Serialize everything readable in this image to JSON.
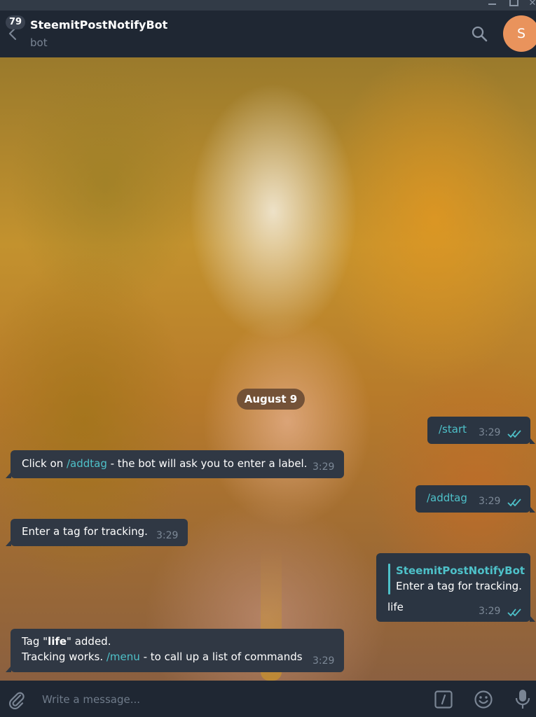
{
  "colors": {
    "accent": "#4ec1c9",
    "header_bg": "#1f2733",
    "avatar_bg": "#e9935c",
    "date_pill_bg": "#6b4c34"
  },
  "header": {
    "unread_count": "79",
    "title": "SteemitPostNotifyBot",
    "status": "bot",
    "avatar_letter": "S",
    "icons": [
      "back-arrow-icon",
      "search-icon"
    ]
  },
  "chat": {
    "date_separator": "August 9",
    "messages": [
      {
        "direction": "outgoing",
        "text": "/start",
        "time": "3:29",
        "read": true
      },
      {
        "direction": "incoming",
        "text_before": "Click on ",
        "command": "/addtag",
        "text_after": " - the bot will ask you to enter a label.",
        "time": "3:29"
      },
      {
        "direction": "outgoing",
        "text": "/addtag",
        "time": "3:29",
        "read": true
      },
      {
        "direction": "incoming",
        "text": "Enter a tag for tracking.",
        "time": "3:29"
      },
      {
        "direction": "outgoing",
        "reply_to_name": "SteemitPostNotifyBot",
        "reply_to_text": "Enter a tag for tracking.",
        "text": "life",
        "time": "3:29",
        "read": true
      },
      {
        "direction": "incoming",
        "line1_before": "Tag \"",
        "line1_bold": "life",
        "line1_after": "\" added.",
        "line2_before": "Tracking works. ",
        "command": "/menu",
        "line2_after": " - to call up a list of commands",
        "time": "3:29"
      }
    ]
  },
  "input": {
    "placeholder": "Write a message...",
    "icons": [
      "paperclip-icon",
      "bot-command-icon",
      "emoji-icon",
      "microphone-icon"
    ]
  }
}
